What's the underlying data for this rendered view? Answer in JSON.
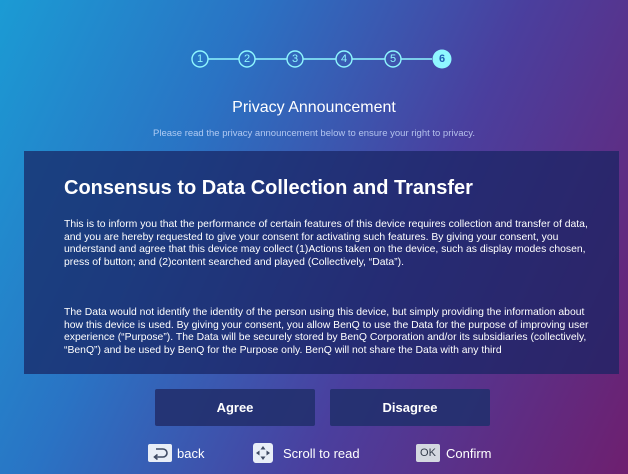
{
  "stepper": {
    "steps": [
      "1",
      "2",
      "3",
      "4",
      "5",
      "6"
    ],
    "current_step": 6
  },
  "page": {
    "title": "Privacy Announcement",
    "subtitle": "Please read the privacy announcement below to ensure your right to privacy."
  },
  "document": {
    "heading": "Consensus to Data Collection and Transfer",
    "paragraphs": [
      "This is to inform you that the performance of certain features of this device requires collection and transfer of data, and you are hereby requested to give your consent for activating such features. By giving your consent, you understand and agree that this device may collect (1)Actions taken on the device, such as display modes chosen, press of button; and (2)content searched and played (Collectively, “Data”).",
      "The Data would not identify the identity of the person using this device, but simply providing the information about how this device is used. By giving your consent, you allow BenQ to use the Data for the purpose of improving user experience (“Purpose”). The Data will be securely stored by BenQ Corporation and/or its subsidiaries (collectively, “BenQ”) and be used by BenQ for the Purpose only. BenQ will not share the Data with any third"
    ]
  },
  "buttons": {
    "agree": "Agree",
    "disagree": "Disagree"
  },
  "footer": {
    "back": "back",
    "scroll": "Scroll to read",
    "confirm_key": "OK",
    "confirm": "Confirm"
  },
  "colors": {
    "step_line": "#8ff7ff",
    "step_active_fill": "#8ff7ff",
    "panel_bg": "#182462",
    "button_bg": "#22306e"
  },
  "icons": {
    "back": "return-arrow-icon",
    "scroll": "dpad-icon",
    "confirm": "ok-key-icon"
  }
}
